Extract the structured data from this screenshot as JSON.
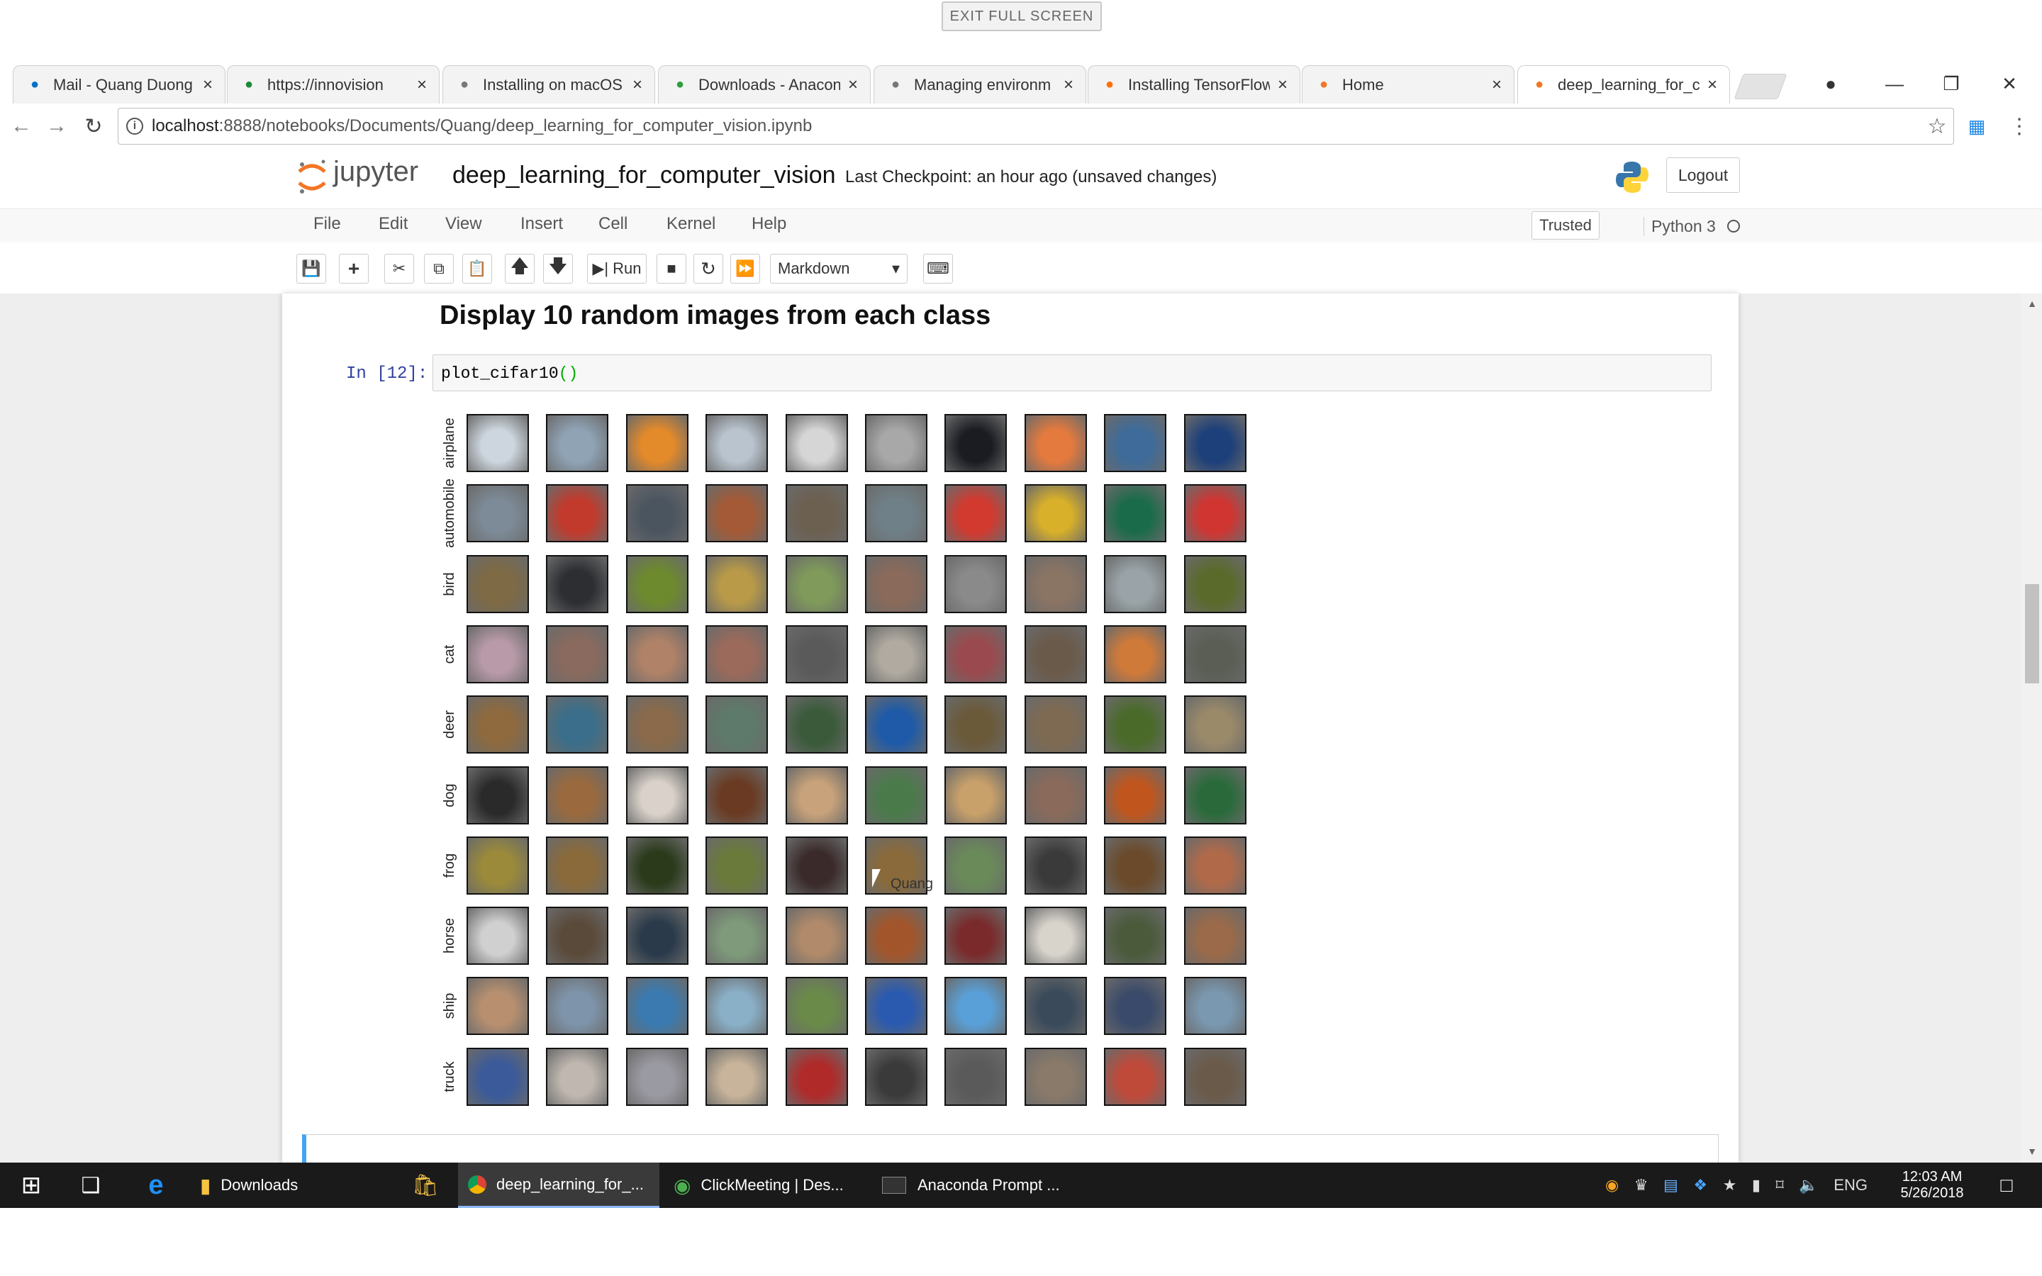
{
  "fullscreen": {
    "exit_label": "EXIT FULL SCREEN"
  },
  "tabs": [
    {
      "title": "Mail - Quang Duong",
      "icon": "outlook-icon",
      "color": "#0072c6"
    },
    {
      "title": "https://innovision",
      "icon": "recording-icon",
      "color": "#1a8a3a"
    },
    {
      "title": "Installing on macOS",
      "icon": "page-icon",
      "color": "#777777"
    },
    {
      "title": "Downloads - Anacon",
      "icon": "anaconda-icon",
      "color": "#2e9e3e"
    },
    {
      "title": "Managing environm",
      "icon": "page-icon",
      "color": "#777777"
    },
    {
      "title": "Installing TensorFlow",
      "icon": "tensorflow-icon",
      "color": "#ff6f00"
    },
    {
      "title": "Home",
      "icon": "jupyter-icon",
      "color": "#f37626"
    },
    {
      "title": "deep_learning_for_c",
      "icon": "jupyter-icon",
      "color": "#f37626"
    }
  ],
  "address": {
    "host": "localhost",
    "path": ":8888/notebooks/Documents/Quang/deep_learning_for_computer_vision.ipynb"
  },
  "jupyter": {
    "logo_text": "jupyter",
    "notebook_name": "deep_learning_for_computer_vision",
    "checkpoint": "Last Checkpoint: an hour ago  (unsaved changes)",
    "logout": "Logout",
    "menu": [
      "File",
      "Edit",
      "View",
      "Insert",
      "Cell",
      "Kernel",
      "Help"
    ],
    "trusted": "Trusted",
    "kernel": "Python 3",
    "run_label": "Run",
    "cell_type": "Markdown"
  },
  "notebook": {
    "heading": "Display 10 random images from each class",
    "prompt": "In [12]:",
    "code_fn": "plot_cifar10",
    "code_paren": "()",
    "classes": [
      "airplane",
      "automobile",
      "bird",
      "cat",
      "deer",
      "dog",
      "frog",
      "horse",
      "ship",
      "truck"
    ],
    "class_palettes": {
      "airplane": [
        "#cdd6de",
        "#8fa3b5",
        "#e38a2a",
        "#b9c4cf",
        "#d6d6d6",
        "#a8a8a8",
        "#1a1c22",
        "#e47a3e",
        "#3e6b9a",
        "#1d3f7a"
      ],
      "automobile": [
        "#7d8b98",
        "#c23a2c",
        "#4b5560",
        "#a45a36",
        "#6c6050",
        "#6f8088",
        "#d2392f",
        "#d9b02a",
        "#1a6b4a",
        "#d13532"
      ],
      "bird": [
        "#7e6a44",
        "#2c2e32",
        "#6d8a2e",
        "#b89a48",
        "#7f9a5a",
        "#8a6a5a",
        "#8a8a8a",
        "#8a7464",
        "#9aa4a8",
        "#5a6a2a"
      ],
      "cat": [
        "#b89aa8",
        "#8a6a5e",
        "#b08268",
        "#9c6a5a",
        "#5a5a5a",
        "#b0aaa0",
        "#9a4a4e",
        "#6a5a4a",
        "#d07a3a",
        "#5a5e54"
      ],
      "deer": [
        "#8e6a3e",
        "#3a6e8a",
        "#8a6a4a",
        "#5e7a6a",
        "#3a5a3a",
        "#1e5aa8",
        "#6a5a3a",
        "#7e6a52",
        "#4a6a2a",
        "#9a8a6a"
      ],
      "dog": [
        "#2a2a2a",
        "#9a6a3e",
        "#dad2ca",
        "#6a3a22",
        "#c8a27a",
        "#4a7a4a",
        "#c8a06a",
        "#8a6a5a",
        "#c0561e",
        "#2a6a3a"
      ],
      "frog": [
        "#9a8a3a",
        "#8a6a3a",
        "#2a3a1a",
        "#6a7a3a",
        "#3a2a2a",
        "#8a6a3a",
        "#6a8a5a",
        "#3a3a3a",
        "#6a4a2a",
        "#b06a4a"
      ],
      "horse": [
        "#d0d0d0",
        "#5a4a3a",
        "#2a3a4a",
        "#7e9a7a",
        "#b08a6a",
        "#a2552a",
        "#7a2a2a",
        "#d8d4cc",
        "#4a5a3a",
        "#9a6a4a"
      ],
      "ship": [
        "#b89070",
        "#7e94aa",
        "#3a7ab0",
        "#8ab0c8",
        "#6a8a4a",
        "#2a5ab0",
        "#5aa0d8",
        "#3a4a5a",
        "#3a4a6a",
        "#7a98b0"
      ],
      "truck": [
        "#3a5a9a",
        "#c0b8b0",
        "#9a9aa2",
        "#c8b49a",
        "#b02a2a",
        "#3a3a3a",
        "#5a5a5a",
        "#8a7a6a",
        "#c04a3a",
        "#6a5a4a"
      ]
    },
    "cursor_label": "Quang"
  },
  "taskbar": {
    "items": [
      "Downloads",
      "deep_learning_for_...",
      "ClickMeeting | Des...",
      "Anaconda Prompt ..."
    ],
    "lang": "ENG",
    "time": "12:03 AM",
    "date": "5/26/2018"
  }
}
